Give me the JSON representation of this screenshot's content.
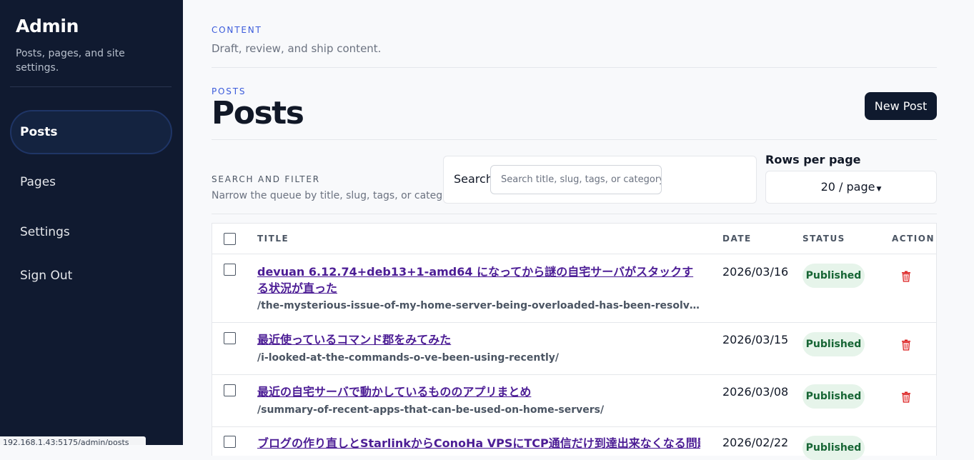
{
  "sidebar": {
    "brand": "Admin",
    "subtitle": "Posts, pages, and site settings.",
    "items": [
      {
        "label": "Posts",
        "active": true
      },
      {
        "label": "Pages"
      },
      {
        "label": "Settings"
      },
      {
        "label": "Sign Out"
      }
    ]
  },
  "status_bar": {
    "url": "192.168.1.43:5175/admin/posts"
  },
  "header": {
    "eyebrow": "CONTENT",
    "subtitle": "Draft, review, and ship content."
  },
  "posts_header": {
    "eyebrow": "POSTS",
    "title": "Posts",
    "new_button": "New Post"
  },
  "filter": {
    "label": "SEARCH AND FILTER",
    "description": "Narrow the queue by title, slug, tags, or category.",
    "search_label": "Search",
    "search_placeholder": "Search title, slug, tags, or category",
    "rows_label": "Rows per page",
    "rows_value": "20 / page"
  },
  "table": {
    "columns": {
      "title": "TITLE",
      "date": "DATE",
      "status": "STATUS",
      "action": "ACTION"
    },
    "rows": [
      {
        "title": "devuan 6.12.74+deb13+1-amd64 になってから謎の自宅サーバがスタックする状況が直った",
        "slug": "/the-mysterious-issue-of-my-home-server-being-overloaded-has-been-resolved-since-upgrading/",
        "date": "2026/03/16",
        "status": "Published"
      },
      {
        "title": "最近使っているコマンド郡をみてみた",
        "slug": "/i-looked-at-the-commands-o-ve-been-using-recently/",
        "date": "2026/03/15",
        "status": "Published"
      },
      {
        "title": "最近の自宅サーバで動かしているもののアプリまとめ",
        "slug": "/summary-of-recent-apps-that-can-be-used-on-home-servers/",
        "date": "2026/03/08",
        "status": "Published"
      },
      {
        "title": "ブログの作り直しとStarlinkからConoHa VPSにTCP通信だけ到達出来なくなる問題の",
        "slug": "",
        "date": "2026/02/22",
        "status": "Published"
      }
    ]
  },
  "colors": {
    "sidebar_bg": "#101a30",
    "accent": "#3b5bdb",
    "link": "#4c1d95",
    "badge_bg": "#e6f4ea",
    "badge_text": "#166534",
    "trash": "#dc2626"
  }
}
